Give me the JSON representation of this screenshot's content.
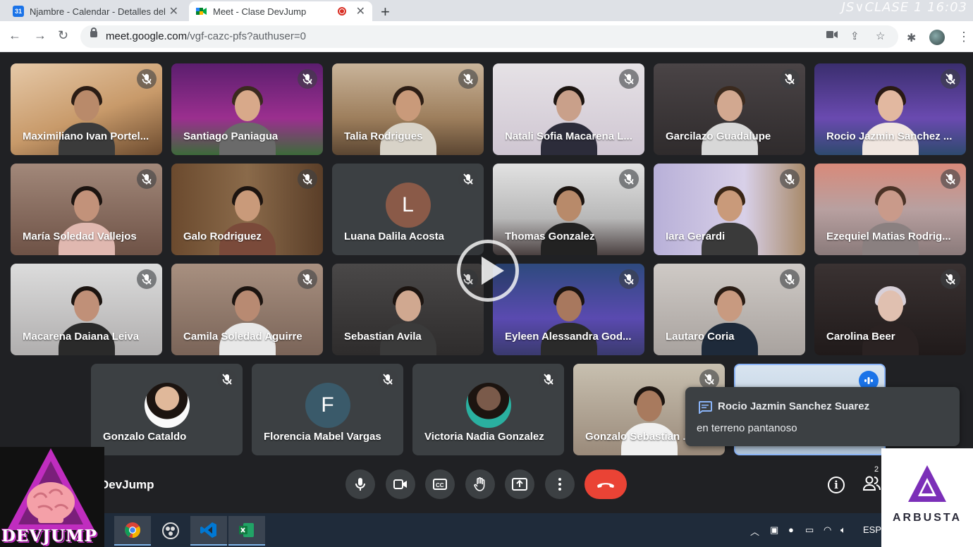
{
  "browser": {
    "tabs": [
      {
        "title": "Njambre - Calendar - Detalles del",
        "favicon": "calendar-icon",
        "active": false
      },
      {
        "title": "Meet - Clase DevJump",
        "favicon": "meet-icon",
        "active": true
      }
    ],
    "url_host": "meet.google.com",
    "url_path": "/vgf-cazc-pfs?authuser=0",
    "overlay_text": "JS∨CLASE 1 16:03"
  },
  "tiles": [
    {
      "name": "Maximiliano Ivan Portel..."
    },
    {
      "name": "Santiago Paniagua"
    },
    {
      "name": "Talia Rodrigues"
    },
    {
      "name": "Natali Sofia Macarena L..."
    },
    {
      "name": "Garcilazo Guadalupe"
    },
    {
      "name": "Rocio Jazmin Sanchez ..."
    },
    {
      "name": "María Soledad Vallejos"
    },
    {
      "name": "Galo Rodriguez"
    },
    {
      "name": "Luana Dalila Acosta",
      "initial": "L"
    },
    {
      "name": "Thomas Gonzalez"
    },
    {
      "name": "Iara Gerardi"
    },
    {
      "name": "Ezequiel Matias Rodrig..."
    },
    {
      "name": "Macarena Daiana Leiva"
    },
    {
      "name": "Camila Soledad Aguirre"
    },
    {
      "name": "Sebastian Avila"
    },
    {
      "name": "Eyleen Alessandra God..."
    },
    {
      "name": "Lautaro Coria"
    },
    {
      "name": "Carolina Beer"
    },
    {
      "name": "Gonzalo Cataldo"
    },
    {
      "name": "Florencia Mabel Vargas",
      "initial": "F"
    },
    {
      "name": "Victoria Nadia Gonzalez"
    },
    {
      "name": "Gonzalo Sebastian ..."
    }
  ],
  "chat_toast": {
    "sender": "Rocio Jazmin Sanchez Suarez",
    "message": "en terreno pantanoso"
  },
  "meeting": {
    "name": "DevJump",
    "participant_count": "2"
  },
  "taskbar": {
    "language": "ESP"
  },
  "logos": {
    "left": "DEVJUMP",
    "right": "ARBUSTA"
  },
  "colors": {
    "end_call": "#ea4335",
    "meet_bg": "#202124",
    "tile_bg": "#3c4043"
  }
}
